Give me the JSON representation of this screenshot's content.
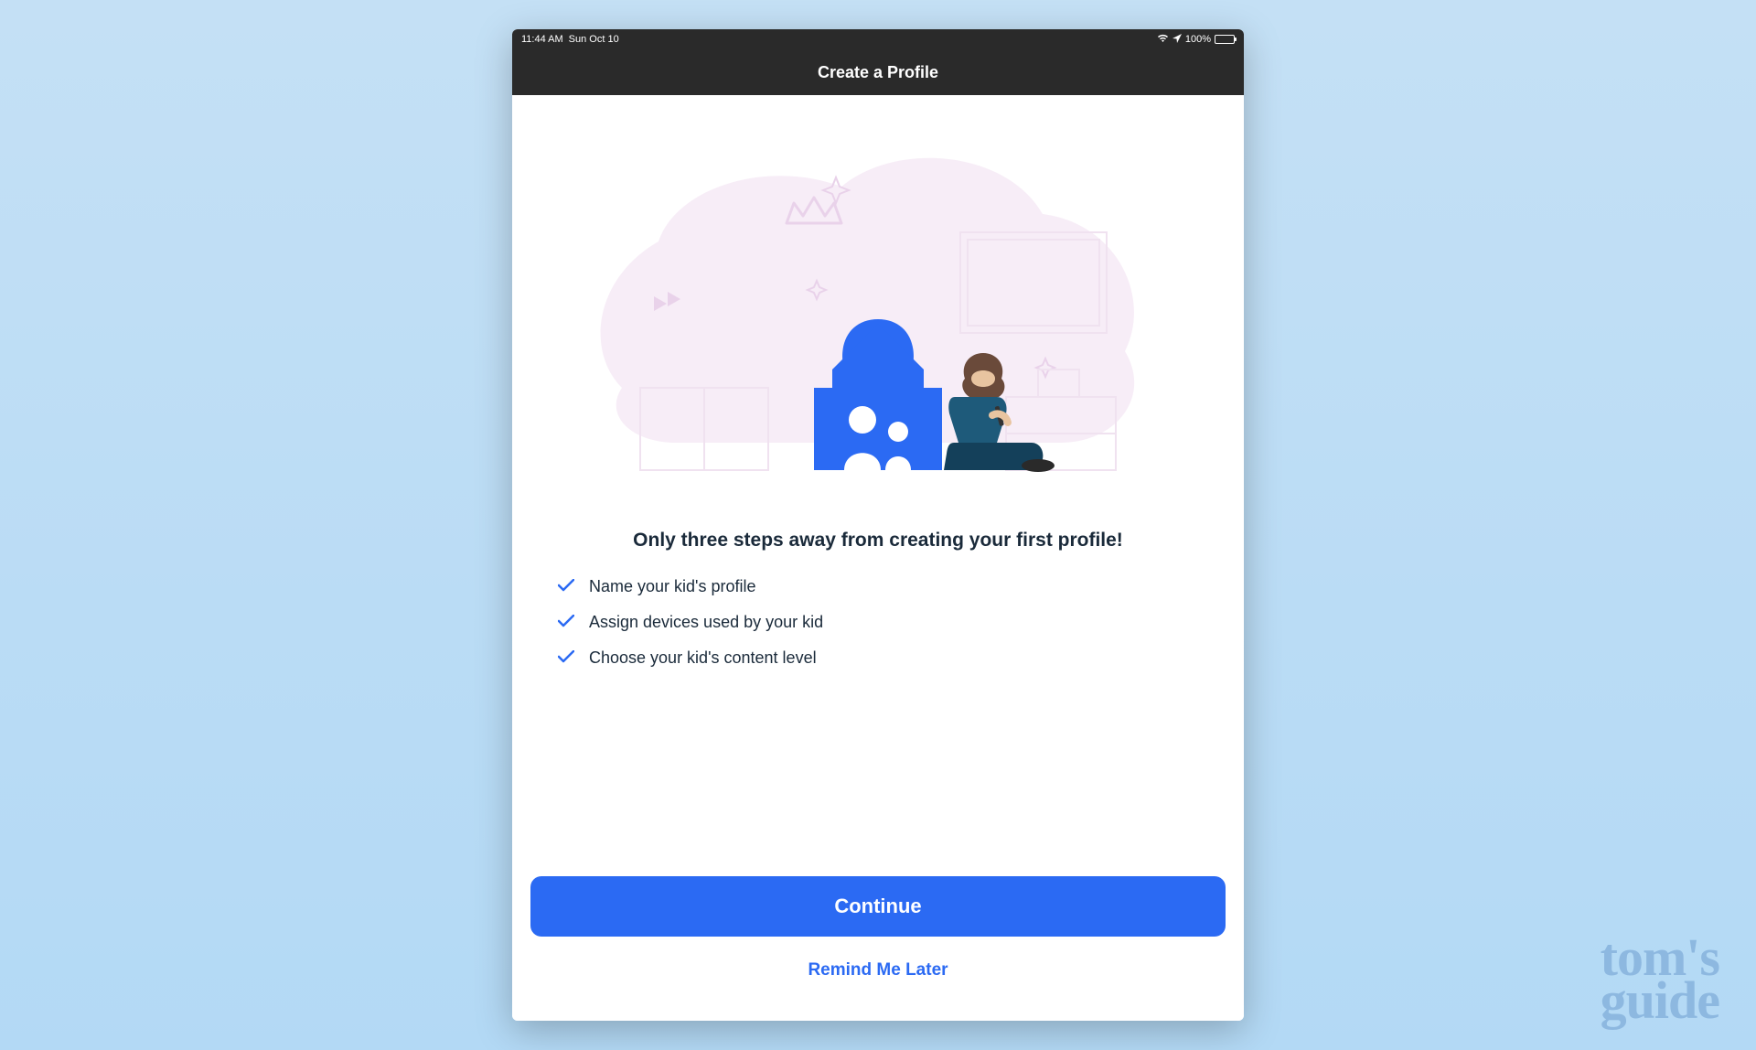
{
  "status": {
    "time": "11:44 AM",
    "date": "Sun Oct 10",
    "battery": "100%"
  },
  "nav": {
    "title": "Create a Profile"
  },
  "main": {
    "headline": "Only three steps away from creating your first profile!",
    "steps": [
      "Name your kid's profile",
      "Assign devices used by your kid",
      "Choose your kid's content level"
    ],
    "primary_button": "Continue",
    "secondary_button": "Remind Me Later"
  },
  "watermark": {
    "line1": "tom's",
    "line2": "guide"
  }
}
